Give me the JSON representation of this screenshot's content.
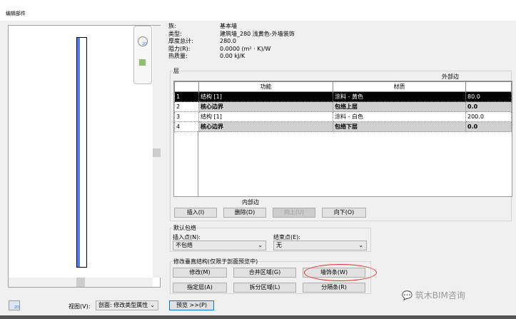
{
  "window": {
    "title": "编辑部件"
  },
  "info": [
    {
      "label": "族:",
      "value": "基本墙"
    },
    {
      "label": "类型:",
      "value": "建筑墙_280 浅黄色-外墙装饰"
    },
    {
      "label": "厚度总计:",
      "value": "280.0"
    },
    {
      "label": "阻力(R):",
      "value": "0.0000 (m² · K)/W"
    },
    {
      "label": "热质量:",
      "value": "0.00 kJ/K"
    }
  ],
  "layers": {
    "group_label": "层",
    "exterior_label": "外部边",
    "interior_label": "内部边",
    "headers": [
      "",
      "功能",
      "材质",
      ""
    ],
    "rows": [
      {
        "num": "1",
        "function": "结构 [1]",
        "material": "涂料 - 黄色",
        "thickness": "80.0"
      },
      {
        "num": "2",
        "function": "核心边界",
        "material": "包络上层",
        "thickness": "0.0"
      },
      {
        "num": "3",
        "function": "结构 [1]",
        "material": "涂料 - 白色",
        "thickness": "200.0"
      },
      {
        "num": "4",
        "function": "核心边界",
        "material": "包络下层",
        "thickness": "0.0"
      }
    ],
    "buttons": {
      "insert": "插入(I)",
      "delete": "删除(D)",
      "up": "向上(U)",
      "down": "向下(O)"
    }
  },
  "wrap": {
    "group_label": "默认包络",
    "insert_label": "插入点(N):",
    "insert_value": "不包络",
    "end_label": "结束点(E):",
    "end_value": "无"
  },
  "modify": {
    "group_label": "修改垂直结构(仅限于剖面预览中)",
    "modify": "修改(M)",
    "merge": "合并区域(G)",
    "sweeps": "墙饰条(W)",
    "assign": "指定层(A)",
    "split": "拆分区域(L)",
    "reveals": "分隔条(R)"
  },
  "bottom": {
    "view_label": "视图(V):",
    "view_value": "剖面: 修改类型属性",
    "preview_button": "预览 >>(P)"
  },
  "watermark": "筑木BIM咨询",
  "colors": {
    "selected_row": "#000000",
    "core_row": "#d0d0d0",
    "wall_finish": "#4f7ff0",
    "highlight": "#e0302a"
  }
}
